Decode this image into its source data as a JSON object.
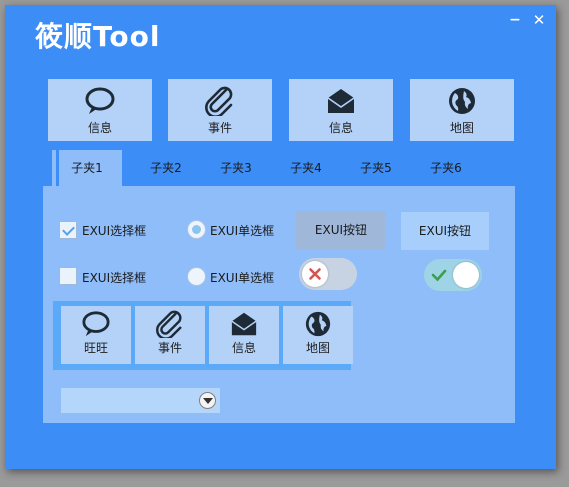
{
  "window": {
    "title": "筱顺Tool",
    "minimize": "−",
    "close": "✕"
  },
  "top_buttons": [
    {
      "label": "信息",
      "icon": "speech-bubble-icon"
    },
    {
      "label": "事件",
      "icon": "paperclip-icon"
    },
    {
      "label": "信息",
      "icon": "envelope-icon"
    },
    {
      "label": "地图",
      "icon": "globe-icon"
    }
  ],
  "tabs": [
    "子夹1",
    "子夹2",
    "子夹3",
    "子夹4",
    "子夹5",
    "子夹6"
  ],
  "active_tab": 0,
  "panel": {
    "checkbox_1": {
      "label": "EXUI选择框",
      "checked": true
    },
    "checkbox_2": {
      "label": "EXUI选择框",
      "checked": false
    },
    "radio_1": {
      "label": "EXUI单选框",
      "selected": true
    },
    "radio_2": {
      "label": "EXUI单选框",
      "selected": false
    },
    "button_1": {
      "label": "EXUI按钮"
    },
    "button_2": {
      "label": "EXUI按钮"
    },
    "toggle_1": {
      "on": false
    },
    "toggle_2": {
      "on": true
    },
    "group_buttons": [
      {
        "label": "旺旺",
        "icon": "speech-bubble-icon"
      },
      {
        "label": "事件",
        "icon": "paperclip-icon"
      },
      {
        "label": "信息",
        "icon": "envelope-icon"
      },
      {
        "label": "地图",
        "icon": "globe-icon"
      }
    ],
    "combo": {
      "value": ""
    }
  },
  "colors": {
    "window_bg": "#3c8ef6",
    "panel_bg": "#8fbdf9",
    "button_bg": "#b4d2f8",
    "icon": "#1e2a36",
    "toggle_off_x": "#d9534f",
    "toggle_on_check": "#3aa04a"
  }
}
